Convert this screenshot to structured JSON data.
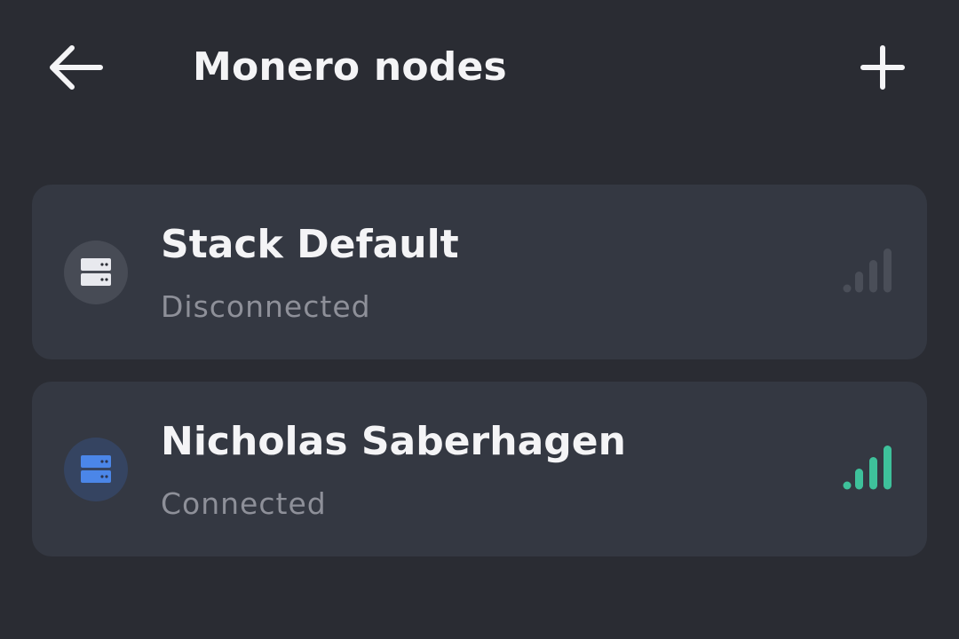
{
  "header": {
    "title": "Monero nodes",
    "back_icon": "arrow-left-icon",
    "add_icon": "plus-icon"
  },
  "nodes": [
    {
      "name": "Stack Default",
      "status": "Disconnected",
      "icon": "server-icon",
      "icon_color": "#e8e9ee",
      "icon_bg": "#474b55",
      "signal_icon": "signal-bars-icon",
      "signal_color": "#4a4e58"
    },
    {
      "name": "Nicholas Saberhagen",
      "status": "Connected",
      "icon": "server-icon",
      "icon_color": "#4b86e8",
      "icon_bg": "#354461",
      "signal_icon": "signal-bars-icon",
      "signal_color": "#3ec19b"
    }
  ],
  "colors": {
    "background": "#2a2c33",
    "card": "#343842",
    "text_primary": "#f4f4f6",
    "text_secondary": "#8e9099"
  }
}
